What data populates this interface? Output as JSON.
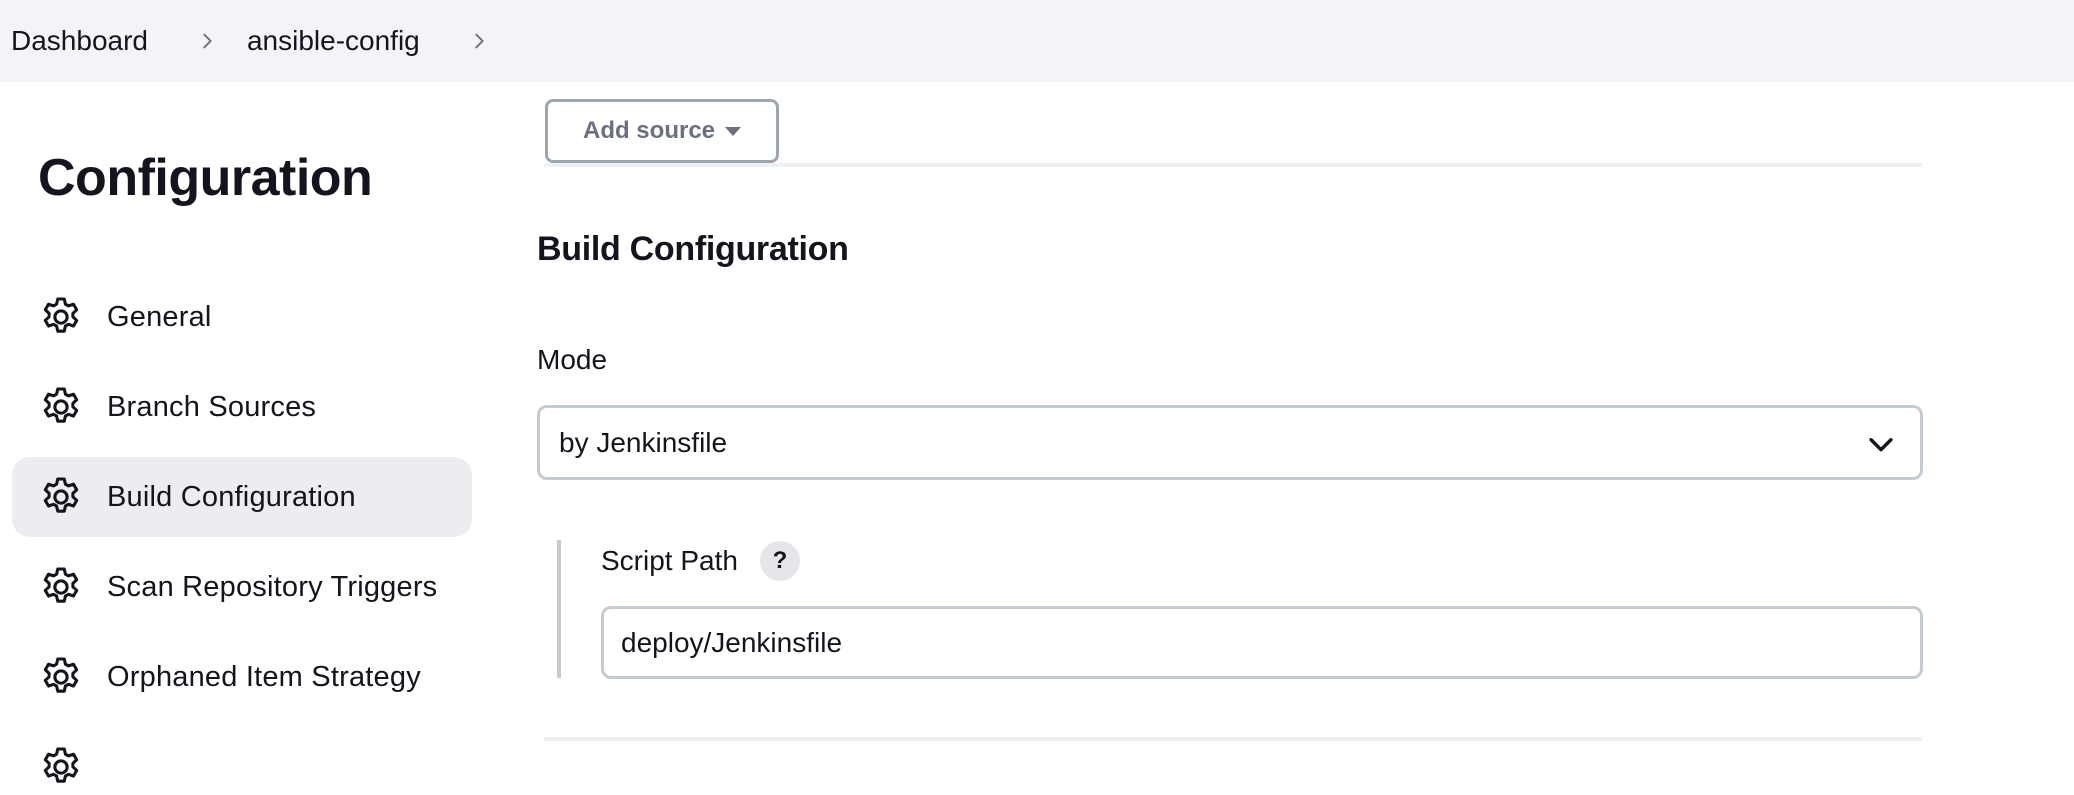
{
  "breadcrumb": {
    "items": [
      "Dashboard",
      "ansible-config"
    ]
  },
  "sidebar": {
    "title": "Configuration",
    "items": [
      {
        "label": "General",
        "icon": "gear-icon"
      },
      {
        "label": "Branch Sources",
        "icon": "gear-icon"
      },
      {
        "label": "Build Configuration",
        "icon": "gear-icon",
        "active": true
      },
      {
        "label": "Scan Repository Triggers",
        "icon": "gear-icon"
      },
      {
        "label": "Orphaned Item Strategy",
        "icon": "gear-icon"
      }
    ]
  },
  "main": {
    "add_source_label": "Add source",
    "section_title": "Build Configuration",
    "mode": {
      "label": "Mode",
      "value": "by Jenkinsfile"
    },
    "script_path": {
      "label": "Script Path",
      "help": "?",
      "value": "deploy/Jenkinsfile"
    }
  },
  "colors": {
    "topbar_bg": "#f4f4f8",
    "active_item_bg": "#ececf1",
    "input_border": "#c4ccd1",
    "text": "#14141f"
  }
}
